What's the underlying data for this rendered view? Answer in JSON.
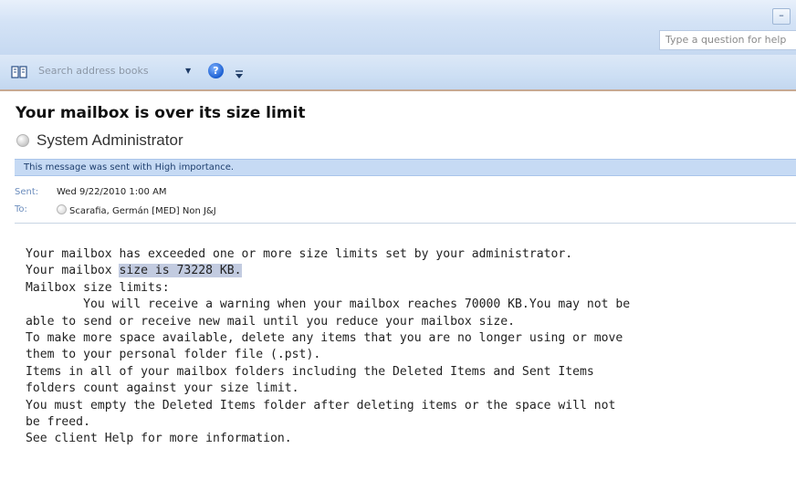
{
  "window": {
    "minimize_glyph": "–",
    "help_search_placeholder": "Type a question for help"
  },
  "toolbar": {
    "address_book_placeholder": "Search address books",
    "dropdown_glyph": "▼",
    "help_glyph": "?"
  },
  "message": {
    "subject": "Your mailbox is over its size limit",
    "sender": "System Administrator",
    "importance_notice": "This message was sent with High importance.",
    "sent_label": "Sent:",
    "sent_value": "Wed 9/22/2010 1:00 AM",
    "to_label": "To:",
    "to_value": "Scarafia, Germán [MED] Non J&J",
    "body": {
      "l1": "Your mailbox has exceeded one or more size limits set by your administrator.",
      "l2_prefix": "Your mailbox ",
      "l2_highlight": "size is 73228 KB.",
      "l3": "Mailbox size limits:",
      "l4": "        You will receive a warning when your mailbox reaches 70000 KB.You may not be",
      "l5": "able to send or receive new mail until you reduce your mailbox size.",
      "l6": "To make more space available, delete any items that you are no longer using or move",
      "l7": "them to your personal folder file (.pst).",
      "l8": "Items in all of your mailbox folders including the Deleted Items and Sent Items",
      "l9": "folders count against your size limit.",
      "l10": "You must empty the Deleted Items folder after deleting items or the space will not",
      "l11": "be freed.",
      "l12": "See client Help for more information."
    }
  },
  "icons": {
    "address_book": "address-book-icon",
    "help": "help-icon",
    "overflow": "toolbar-overflow-icon",
    "presence": "presence-status-icon"
  },
  "colors": {
    "importance_bar": "#c6daf4",
    "highlight": "#c2cbe0",
    "toolbar_border": "#c7a993"
  }
}
